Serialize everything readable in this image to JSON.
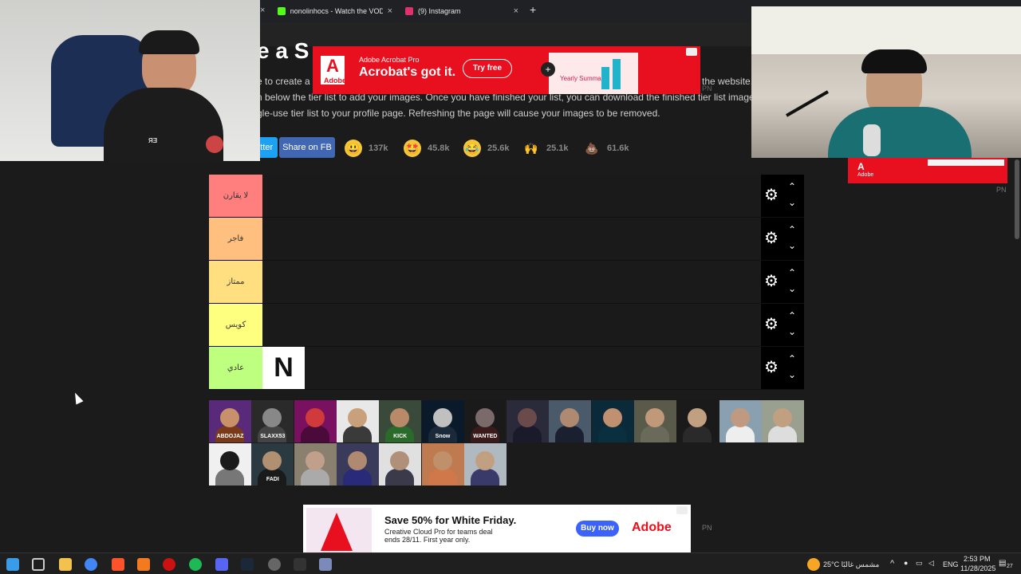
{
  "browser": {
    "tabs": [
      {
        "label": "nonolinhocs - Watch the VOD",
        "icon_color": "#53fc18",
        "icon": "kick-icon"
      },
      {
        "label": "(9) Instagram",
        "icon_color": "#e1306c",
        "icon": "instagram-icon"
      }
    ],
    "close_glyph": "×",
    "new_tab_glyph": "+"
  },
  "page": {
    "title": "e a S",
    "intro_line1": "e to create a s",
    "intro_line1_end": "the website.",
    "intro_line2": "n below the tier list to add your images. Once you have finished your list, you can download the finished tier list image. It is",
    "intro_line3": "gle-use tier list to your profile page. Refreshing the page will cause your images to be removed."
  },
  "share": {
    "twitter_label": "itter",
    "fb_label": "Share on FB"
  },
  "reactions": [
    {
      "icon": "grinning-face-icon",
      "glyph": "😃",
      "count": "137k"
    },
    {
      "icon": "star-struck-icon",
      "glyph": "🤩",
      "count": "45.8k"
    },
    {
      "icon": "joy-icon",
      "glyph": "😂",
      "count": "25.6k"
    },
    {
      "icon": "raised-hands-icon",
      "glyph": "🙌",
      "count": "25.1k"
    },
    {
      "icon": "poop-icon",
      "glyph": "💩",
      "count": "61.6k"
    }
  ],
  "tiers": [
    {
      "label": "لا يقارن",
      "color": "#ff7f7f"
    },
    {
      "label": "فاجر",
      "color": "#ffbf7f"
    },
    {
      "label": "ممتاز",
      "color": "#ffdf7f"
    },
    {
      "label": "كويس",
      "color": "#ffff7f"
    },
    {
      "label": "عادي",
      "color": "#bfff7f"
    }
  ],
  "tier_controls": {
    "gear_glyph": "⚙",
    "up_glyph": "⌃",
    "down_glyph": "⌄"
  },
  "placed_item": {
    "tier": 4,
    "text": "N"
  },
  "pool_items": [
    {
      "bg": "#5a2a7a",
      "face": "#c8916a",
      "body": "#7a3a1a",
      "text": "ABDOJAZ"
    },
    {
      "bg": "#2a2a2a",
      "face": "#888888",
      "body": "#444444",
      "text": "SLAXX53"
    },
    {
      "bg": "#7a1060",
      "face": "#d03a3a",
      "body": "#4a0a3a",
      "text": ""
    },
    {
      "bg": "#e8e8e8",
      "face": "#c9a07c",
      "body": "#3a3a3a",
      "text": ""
    },
    {
      "bg": "#3a4a3a",
      "face": "#b88a6a",
      "body": "#2a6a2a",
      "text": "KICK"
    },
    {
      "bg": "#0a1a2a",
      "face": "#c0c0c0",
      "body": "#1a2a3a",
      "text": "Snow"
    },
    {
      "bg": "#1a1a1a",
      "face": "#7a6a6a",
      "body": "#3a1a1a",
      "text": "WANTED"
    },
    {
      "bg": "#2a2a3a",
      "face": "#6a4a4a",
      "body": "#1a1a2a",
      "text": ""
    },
    {
      "bg": "#4a5a6a",
      "face": "#b08a70",
      "body": "#1a2030",
      "text": ""
    },
    {
      "bg": "#0a2a3a",
      "face": "#c09070",
      "body": "#0a3040",
      "text": ""
    },
    {
      "bg": "#5a5a4a",
      "face": "#c0987a",
      "body": "#6a6a5a",
      "text": ""
    },
    {
      "bg": "#1a1a1a",
      "face": "#c0a080",
      "body": "#2a2a2a",
      "text": ""
    },
    {
      "bg": "#8aa0b0",
      "face": "#c09a80",
      "body": "#eeeeee",
      "text": ""
    },
    {
      "bg": "#9aa090",
      "face": "#c0a080",
      "body": "#dddddd",
      "text": ""
    },
    {
      "bg": "#f0f0f0",
      "face": "#1a1a1a",
      "body": "#777777",
      "text": ""
    },
    {
      "bg": "#2a3a40",
      "face": "#b09070",
      "body": "#1a1a1a",
      "text": "FADI"
    },
    {
      "bg": "#8a8070",
      "face": "#c0a08a",
      "body": "#aaaaaa",
      "text": ""
    },
    {
      "bg": "#3a3a5a",
      "face": "#b08a70",
      "body": "#2a2a7a",
      "text": ""
    },
    {
      "bg": "#e0e0e0",
      "face": "#b09078",
      "body": "#3a3a4a",
      "text": ""
    },
    {
      "bg": "#c07a50",
      "face": "#c0906a",
      "body": "#d0784a",
      "text": ""
    },
    {
      "bg": "#b0b8c0",
      "face": "#c0a080",
      "body": "#3a3a6a",
      "text": ""
    }
  ],
  "ads": {
    "top": {
      "brand": "Adobe",
      "small": "Adobe Acrobat Pro",
      "headline": "Acrobat's got it.",
      "cta": "Try free",
      "promo": "Yearly Summary"
    },
    "bottom": {
      "headline": "Save 50% for White Friday.",
      "body1": "Creative Cloud Pro for teams deal",
      "body2": "ends 28/11. First year only.",
      "cta": "Buy now",
      "brand": "Adobe"
    },
    "right": {
      "brand": "Adobe"
    },
    "pn_label": "PN"
  },
  "taskbar": {
    "weather": "25°C  مشمس غالبًا",
    "lang": "ENG",
    "time": "2:53 PM",
    "date": "11/28/2025",
    "notif_count": "27"
  }
}
